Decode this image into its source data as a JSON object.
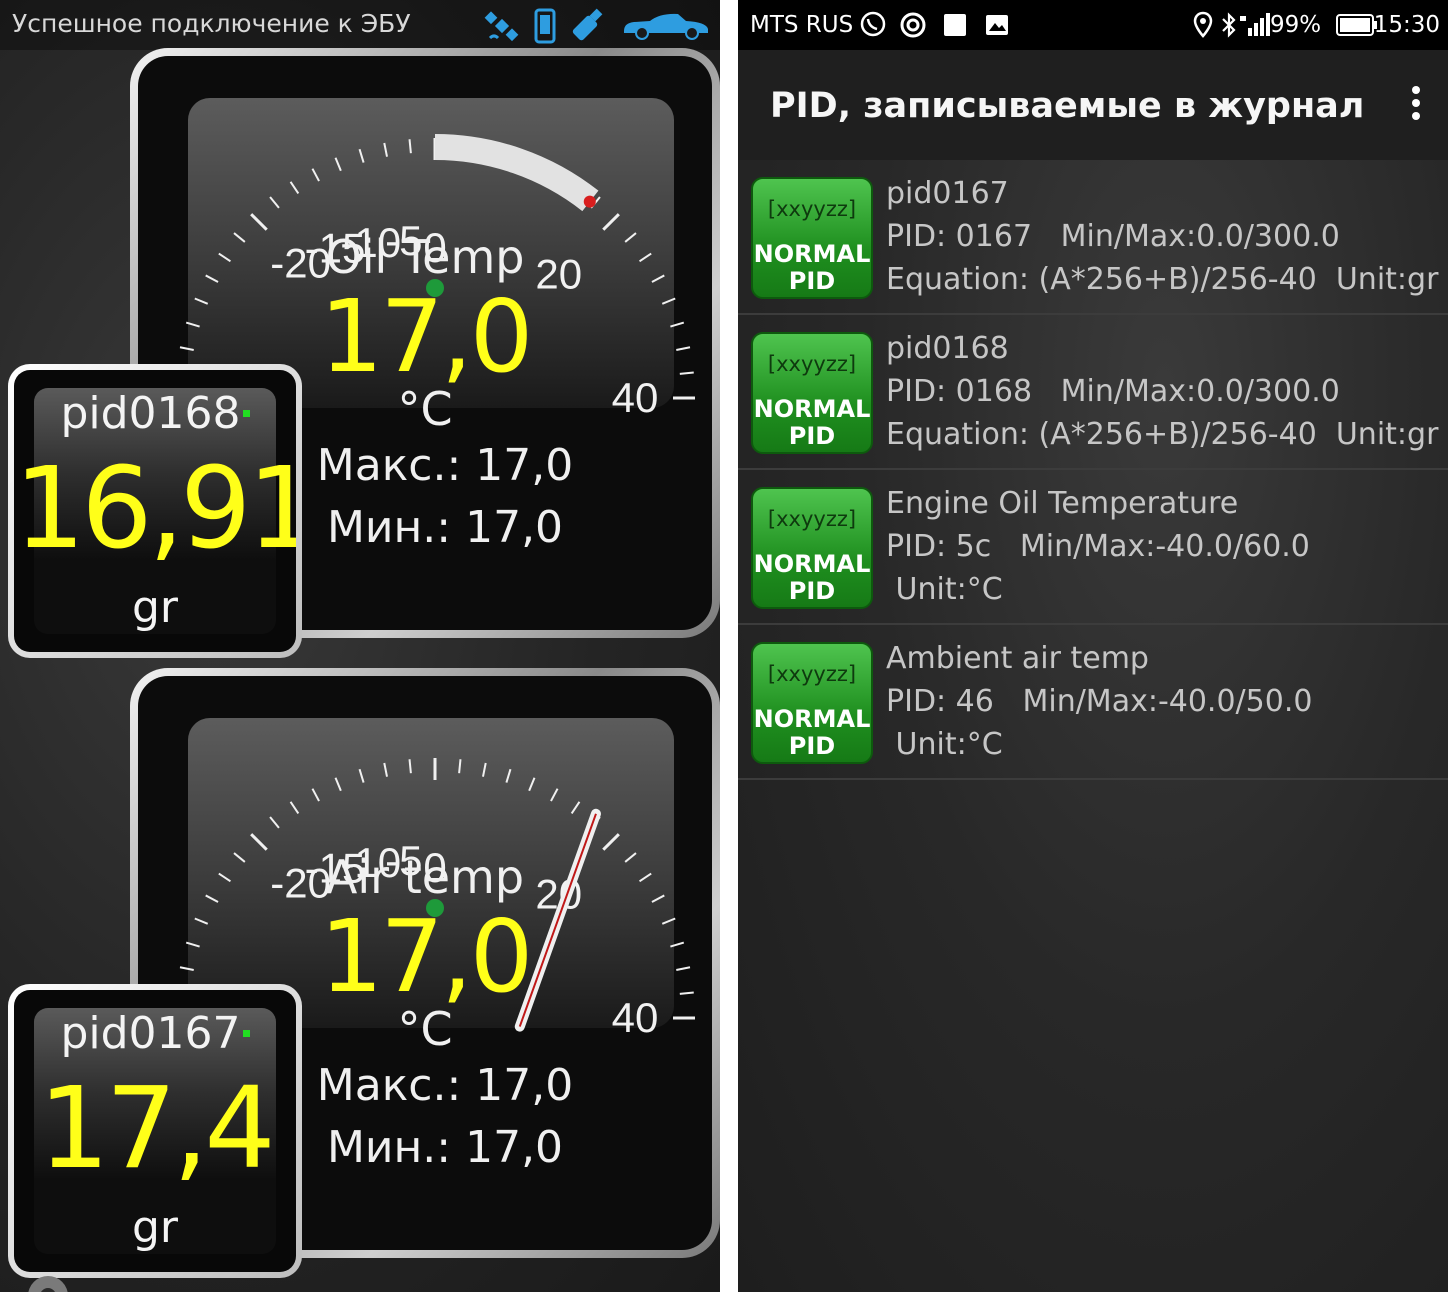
{
  "left": {
    "status": {
      "title": "Успешное подключение к ЭБУ"
    },
    "icons": [
      "satellite-icon",
      "phone-icon",
      "adapter-icon",
      "car-icon"
    ],
    "gauges": [
      {
        "name": "Oil Temp",
        "value": "17,0",
        "unit": "°C",
        "max_label": "Макс.: 17,0",
        "min_label": "Мин.: 17,0",
        "scale_labels": [
          "-20",
          "-15",
          "-10",
          "-5",
          "0",
          "20",
          "40"
        ],
        "needle_value": 17,
        "scale_min": -40,
        "scale_max": 40
      },
      {
        "name": "Air temp",
        "value": "17,0",
        "unit": "°C",
        "max_label": "Макс.: 17,0",
        "min_label": "Мин.: 17,0",
        "scale_labels": [
          "-20",
          "-15",
          "-10",
          "-5",
          "0",
          "20",
          "40"
        ],
        "needle_value": 17,
        "scale_min": -40,
        "scale_max": 40
      }
    ],
    "tiles": [
      {
        "name": "pid0168",
        "value": "16,91",
        "unit": "gr"
      },
      {
        "name": "pid0167",
        "value": "17,4",
        "unit": "gr"
      }
    ]
  },
  "right": {
    "status": {
      "carrier": "MTS RUS",
      "battery": "99%",
      "time": "15:30"
    },
    "title": "PID, записываемые в журнал",
    "badge_top": "[xxyyzz]",
    "badge_bottom_1": "NORMAL",
    "badge_bottom_2": "PID",
    "items": [
      {
        "name": "pid0167",
        "pid": "PID: 0167",
        "minmax": "Min/Max:0.0/300.0",
        "line3": "Equation: (A*256+B)/256-40  Unit:gr"
      },
      {
        "name": "pid0168",
        "pid": "PID: 0168",
        "minmax": "Min/Max:0.0/300.0",
        "line3": "Equation: (A*256+B)/256-40  Unit:gr"
      },
      {
        "name": "Engine Oil Temperature",
        "pid": "PID: 5c",
        "minmax": "Min/Max:-40.0/60.0",
        "line3": " Unit:°C"
      },
      {
        "name": "Ambient air temp",
        "pid": "PID: 46",
        "minmax": "Min/Max:-40.0/50.0",
        "line3": " Unit:°C"
      }
    ],
    "colors": {
      "badge_green": "#2da62d",
      "value_yellow": "#ffff19"
    }
  }
}
